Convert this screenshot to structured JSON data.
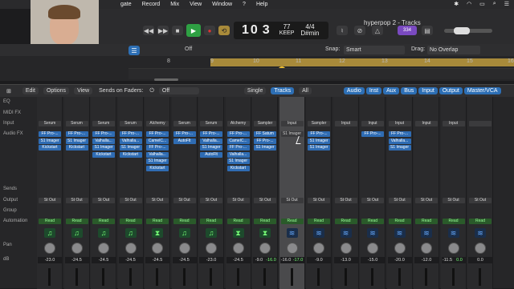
{
  "menubar": {
    "items": [
      "gate",
      "Record",
      "Mix",
      "View",
      "Window",
      "?",
      "Help"
    ]
  },
  "window_title": "hyperpop 2 - Tracks",
  "lcd": {
    "bar": "10",
    "beat": "3",
    "bar_label": "BAR",
    "beat_label": "BEAT",
    "tempo": "77",
    "tempo_label": "TEMPO",
    "keep": "KEEP",
    "sig": "4/4",
    "key": "D#min"
  },
  "badge": "334",
  "ruler": {
    "snap_label": "Snap:",
    "snap_value": "Smart",
    "drag_label": "Drag:",
    "drag_value": "No Overlap",
    "off": "Off",
    "bars": [
      "8",
      "9",
      "10",
      "11",
      "12",
      "13",
      "14",
      "15",
      "16"
    ]
  },
  "mixer": {
    "edit": "Edit",
    "options": "Options",
    "view": "View",
    "sends_on_faders": "Sends on Faders:",
    "sends_value": "Off",
    "views": [
      "Single",
      "Tracks",
      "All"
    ],
    "filters": [
      "Audio",
      "Inst",
      "Aux",
      "Bus",
      "Input",
      "Output",
      "Master/VCA"
    ],
    "row_labels": [
      "EQ",
      "MIDI FX",
      "Input",
      "Audio FX",
      "Sends",
      "Output",
      "Group",
      "Automation",
      "Pan",
      "dB"
    ],
    "strips": [
      {
        "input": "Serum",
        "fx": [
          "FF Pro-...",
          "S1 Imager",
          "Kickstart"
        ],
        "output": "St Out",
        "auto": "Read",
        "db": "-23.0",
        "icon": "♫"
      },
      {
        "input": "Serum",
        "fx": [
          "FF Pro-...",
          "S1 Imager",
          "Kickstart"
        ],
        "output": "St Out",
        "auto": "Read",
        "db": "-24.5",
        "icon": "♫"
      },
      {
        "input": "Serum",
        "fx": [
          "FF Pro-...",
          "Valhalla...",
          "S1 Imager",
          "Kickstart"
        ],
        "output": "St Out",
        "auto": "Read",
        "db": "-24.5",
        "icon": "♫"
      },
      {
        "input": "Serum",
        "fx": [
          "FF Pro-...",
          "Valhalla...",
          "S1 Imager",
          "Kickstart"
        ],
        "output": "St Out",
        "auto": "Read",
        "db": "-24.5",
        "icon": "♫"
      },
      {
        "input": "Alchemy",
        "fx": [
          "FF Pro-...",
          "CamelC...",
          "FF Pro-...",
          "Valhalla...",
          "S1 Imager",
          "Kickstart"
        ],
        "output": "St Out",
        "auto": "Read",
        "db": "-24.5",
        "icon": "⧗"
      },
      {
        "input": "Serum",
        "fx": [
          "FF Pro-...",
          "AutoFlt"
        ],
        "output": "St Out",
        "auto": "Read",
        "db": "-24.5",
        "icon": "♫"
      },
      {
        "input": "Serum",
        "fx": [
          "FF Pro-...",
          "Valhalla...",
          "S1 Imager",
          "AutoFlt"
        ],
        "output": "St Out",
        "auto": "Read",
        "db": "-23.0",
        "icon": "♫"
      },
      {
        "input": "Alchemy",
        "fx": [
          "FF Pro-...",
          "CamelC...",
          "FF Pro-...",
          "Valhalla...",
          "S1 Imager",
          "Kickstart"
        ],
        "output": "St Out",
        "auto": "Read",
        "db": "-24.5",
        "icon": "⧗"
      },
      {
        "input": "Sampler",
        "fx": [
          "FF Satum",
          "FF Pro-...",
          "S1 Imager"
        ],
        "output": "St Out",
        "auto": "Read",
        "db": "-9.0",
        "db2": "-16.0",
        "icon": "⧗"
      },
      {
        "input": "Input",
        "fx": [
          "S1 Imager"
        ],
        "output": "St Out",
        "auto": "Read",
        "db": "-16.0",
        "db2": "-17.0",
        "icon": "≋",
        "selected": true
      },
      {
        "input": "Sampler",
        "fx": [
          "FF Pro-...",
          "S1 Imager",
          "S1 Imager"
        ],
        "output": "St Out",
        "auto": "Read",
        "db": "-9.0",
        "icon": "≋"
      },
      {
        "input": "Input",
        "fx": [],
        "output": "St Out",
        "auto": "Read",
        "db": "-13.0",
        "icon": "≋"
      },
      {
        "input": "Input",
        "fx": [
          "FF Pro-..."
        ],
        "output": "St Out",
        "auto": "Read",
        "db": "-15.0",
        "icon": "≋"
      },
      {
        "input": "Input",
        "fx": [
          "FF Pro-...",
          "Valhalla...",
          "S1 Imager"
        ],
        "output": "St Out",
        "auto": "Read",
        "db": "-20.0",
        "icon": "≋"
      },
      {
        "input": "Input",
        "fx": [],
        "output": "St Out",
        "auto": "Read",
        "db": "-12.0",
        "icon": "≋"
      },
      {
        "input": "Input",
        "fx": [],
        "output": "St Out",
        "auto": "Read",
        "db": "-11.5",
        "db2": "0.0",
        "icon": "≋"
      },
      {
        "input": "",
        "fx": [],
        "output": "St Out",
        "auto": "Read",
        "db": "0.0",
        "icon": "≋"
      }
    ]
  },
  "colors": {
    "accent": "#2f6cb3",
    "play": "#2ea043",
    "record": "#d33",
    "cycle": "#a88a3a"
  }
}
